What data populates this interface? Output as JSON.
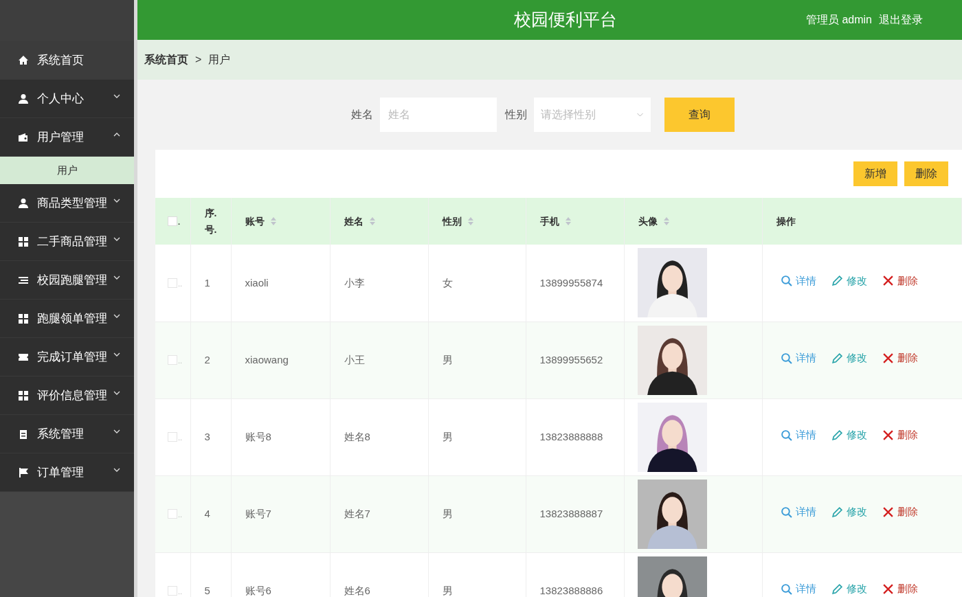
{
  "header": {
    "title": "校园便利平台",
    "user": "管理员 admin",
    "logout": "退出登录"
  },
  "sidebar": {
    "items": [
      {
        "label": "系统首页",
        "kind": "link",
        "selected": false
      },
      {
        "label": "个人中心",
        "kind": "menu",
        "expanded": false,
        "selected": false
      },
      {
        "label": "用户管理",
        "kind": "menu",
        "expanded": true,
        "selected": false,
        "children": [
          {
            "label": "用户",
            "selected": true
          }
        ]
      },
      {
        "label": "商品类型管理",
        "kind": "menu",
        "expanded": false,
        "selected": false
      },
      {
        "label": "二手商品管理",
        "kind": "menu",
        "expanded": false,
        "selected": false
      },
      {
        "label": "校园跑腿管理",
        "kind": "menu",
        "expanded": false,
        "selected": false
      },
      {
        "label": "跑腿领单管理",
        "kind": "menu",
        "expanded": false,
        "selected": false
      },
      {
        "label": "完成订单管理",
        "kind": "menu",
        "expanded": false,
        "selected": false
      },
      {
        "label": "评价信息管理",
        "kind": "menu",
        "expanded": false,
        "selected": false
      },
      {
        "label": "系统管理",
        "kind": "menu",
        "expanded": false,
        "selected": false
      },
      {
        "label": "订单管理",
        "kind": "menu",
        "expanded": false,
        "selected": false
      }
    ]
  },
  "breadcrumb": [
    "系统首页",
    ">",
    "用户"
  ],
  "search": {
    "name_label": "姓名",
    "name_placeholder": "姓名",
    "gender_label": "性别",
    "gender_placeholder": "请选择性别",
    "button": "查询"
  },
  "toolbar": {
    "buttons": [
      "新增",
      "删除"
    ]
  },
  "table": {
    "header_checkbox": {
      "label": ".",
      "checked": false
    },
    "columns": [
      {
        "label": "序.号.",
        "sortable": false
      },
      {
        "label": "账号",
        "sortable": true
      },
      {
        "label": "姓名",
        "sortable": true
      },
      {
        "label": "性别",
        "sortable": true
      },
      {
        "label": "手机",
        "sortable": true
      },
      {
        "label": "头像",
        "sortable": true
      },
      {
        "label": "操作",
        "sortable": false
      }
    ],
    "rows": [
      {
        "checked": false,
        "check_label": "..",
        "index": "1",
        "account": "xiaoli",
        "name": "小李",
        "gender": "女",
        "phone": "13899955874",
        "actions": [
          {
            "kind": "view",
            "label": "详情"
          },
          {
            "kind": "edit",
            "label": "修改"
          },
          {
            "kind": "delete",
            "label": "删除"
          }
        ]
      },
      {
        "checked": false,
        "check_label": "..",
        "index": "2",
        "account": "xiaowang",
        "name": "小王",
        "gender": "男",
        "phone": "13899955652",
        "actions": [
          {
            "kind": "view",
            "label": "详情"
          },
          {
            "kind": "edit",
            "label": "修改"
          },
          {
            "kind": "delete",
            "label": "删除"
          }
        ]
      },
      {
        "checked": false,
        "check_label": "..",
        "index": "3",
        "account": "账号8",
        "name": "姓名8",
        "gender": "男",
        "phone": "13823888888",
        "actions": [
          {
            "kind": "view",
            "label": "详情"
          },
          {
            "kind": "edit",
            "label": "修改"
          },
          {
            "kind": "delete",
            "label": "删除"
          }
        ]
      },
      {
        "checked": false,
        "check_label": "..",
        "index": "4",
        "account": "账号7",
        "name": "姓名7",
        "gender": "男",
        "phone": "13823888887",
        "actions": [
          {
            "kind": "view",
            "label": "详情"
          },
          {
            "kind": "edit",
            "label": "修改"
          },
          {
            "kind": "delete",
            "label": "删除"
          }
        ]
      },
      {
        "checked": false,
        "check_label": "..",
        "index": "5",
        "account": "账号6",
        "name": "姓名6",
        "gender": "男",
        "phone": "13823888886",
        "actions": [
          {
            "kind": "view",
            "label": "详情"
          },
          {
            "kind": "edit",
            "label": "修改"
          },
          {
            "kind": "delete",
            "label": "删除"
          }
        ]
      }
    ]
  }
}
